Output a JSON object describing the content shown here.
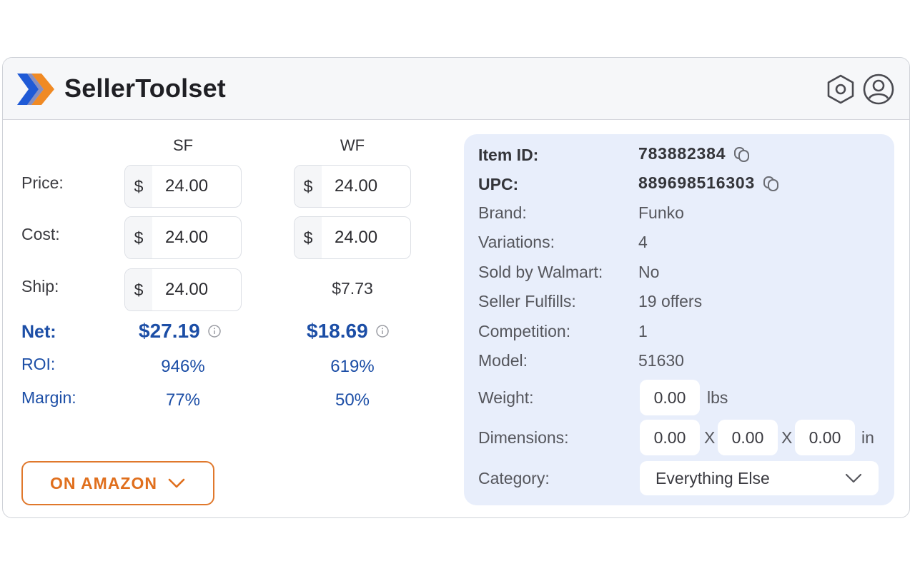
{
  "app": {
    "title": "SellerToolset"
  },
  "header": {
    "settings_icon": "gear-icon",
    "account_icon": "user-icon"
  },
  "colors": {
    "accent_blue": "#1c4ea6",
    "accent_orange": "#e06f1d",
    "details_bg": "#e8eefb"
  },
  "calculator": {
    "columns": [
      "SF",
      "WF"
    ],
    "labels": {
      "price": "Price:",
      "cost": "Cost:",
      "ship": "Ship:",
      "net": "Net:",
      "roi": "ROI:",
      "margin": "Margin:"
    },
    "currency_symbol": "$",
    "sf": {
      "price": "24.00",
      "cost": "24.00",
      "ship": "24.00",
      "net": "$27.19",
      "roi": "946%",
      "margin": "77%"
    },
    "wf": {
      "price": "24.00",
      "cost": "24.00",
      "ship": "$7.73",
      "net": "$18.69",
      "roi": "619%",
      "margin": "50%"
    },
    "amazon_button": "ON AMAZON"
  },
  "details": {
    "item_id_label": "Item ID:",
    "item_id": "783882384",
    "upc_label": "UPC:",
    "upc": "889698516303",
    "brand_label": "Brand:",
    "brand": "Funko",
    "variations_label": "Variations:",
    "variations": "4",
    "sold_by_label": "Sold by Walmart:",
    "sold_by": "No",
    "seller_fulfills_label": "Seller Fulfills:",
    "seller_fulfills": "19 offers",
    "competition_label": "Competition:",
    "competition": "1",
    "model_label": "Model:",
    "model": "51630",
    "weight_label": "Weight:",
    "weight": "0.00",
    "weight_unit": "lbs",
    "dimensions_label": "Dimensions:",
    "dim_l": "0.00",
    "dim_w": "0.00",
    "dim_h": "0.00",
    "dim_sep": "X",
    "dim_unit": "in",
    "category_label": "Category:",
    "category": "Everything Else"
  }
}
